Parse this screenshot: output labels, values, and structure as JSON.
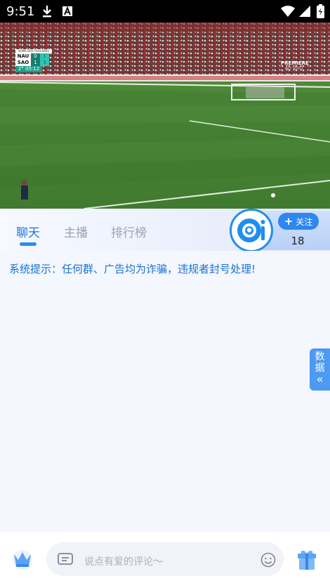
{
  "status_bar": {
    "time": "9:51"
  },
  "video": {
    "scoreboard": {
      "header": "SOMA DOS PLACARES",
      "home_team": "NAU",
      "home_goals": "0",
      "home_agg": "1",
      "away_team": "SAO",
      "away_goals": "1",
      "away_agg": "3",
      "clock": "2° 05:12"
    },
    "broadcaster": "PREMIERE",
    "live_label": "AO VIVO"
  },
  "tabs": [
    {
      "label": "聊天",
      "active": true
    },
    {
      "label": "主播",
      "active": false
    },
    {
      "label": "排行榜",
      "active": false
    }
  ],
  "follow": {
    "button_label": "关注",
    "count": "18"
  },
  "chat": {
    "system_message": "系统提示：任何群、广告均为诈骗，违规者封号处理!"
  },
  "data_tab": {
    "line1": "数",
    "line2": "据",
    "arrow": "«"
  },
  "input_bar": {
    "placeholder": "说点有爱的评论～"
  },
  "colors": {
    "accent": "#1a74d6",
    "follow_button": "#2e86ef",
    "data_tab": "#4c9af2"
  }
}
